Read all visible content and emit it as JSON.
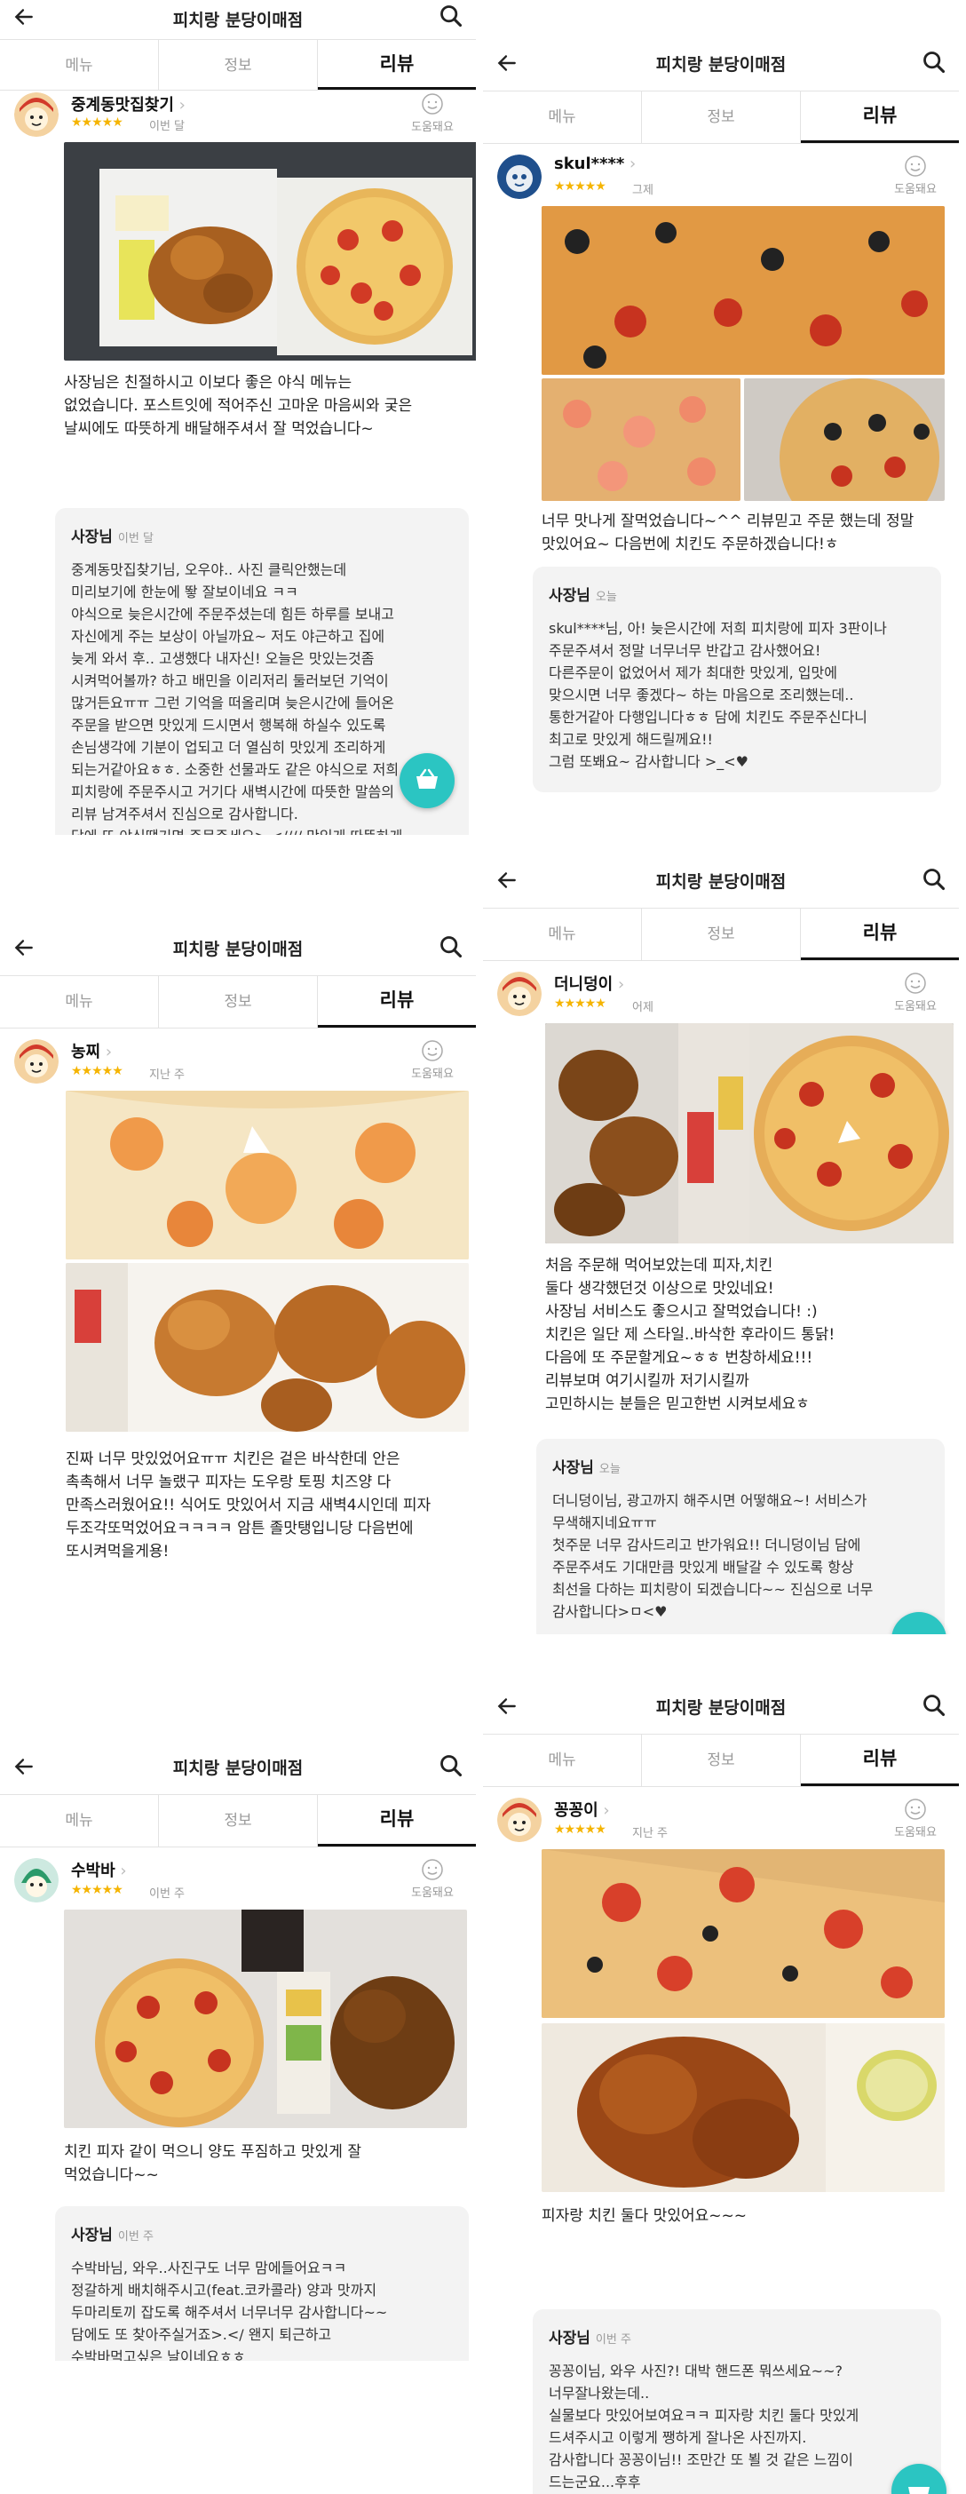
{
  "app": {
    "store_title": "피치랑 분당이매점",
    "tabs": [
      "메뉴",
      "정보",
      "리뷰"
    ],
    "helpful_label": "도움돼요",
    "owner_label": "사장님"
  },
  "reviews": [
    {
      "user": "중계동맛집찾기",
      "stars": "★★★★★",
      "when": "이번 달",
      "text": "사장님은 친절하시고 이보다 좋은 야식 메뉴는\n없었습니다. 포스트잇에 적어주신 고마운 마음씨와 궂은\n날씨에도 따뜻하게 배달해주셔서 잘 먹었습니다~",
      "reply_when": "이번 달",
      "reply": "중계동맛집찾기님,  오우야.. 사진 클릭안했는데\n미리보기에 한눈에 뙇 잘보이네요 ㅋㅋ\n야식으로 늦은시간에 주문주셨는데 힘든 하루를 보내고\n자신에게 주는 보상이 아닐까요~ 저도 야근하고 집에\n늦게 와서 후.. 고생했다 내자신! 오늘은 맛있는것좀\n시켜먹어볼까? 하고 배민을 이리저리 둘러보던 기억이\n많거든요ㅠㅠ 그런 기억을 떠올리며 늦은시간에 들어온\n주문을 받으면 맛있게 드시면서 행복해 하실수 있도록\n손님생각에 기분이 업되고 더 열심히 맛있게 조리하게\n되는거같아요ㅎㅎ. 소중한 선물과도 같은 야식으로 저희\n피치랑에 주문주시고 거기다 새벽시간에 따뜻한 말씀의\n리뷰 남겨주셔서 진심으로 감사합니다.\n 담에 또 야식땡기면 주문주세요>.<//// 맛있게 따뜻하게\n배달하겠습니다~!"
    },
    {
      "user": "skul****",
      "stars": "★★★★★",
      "when": "그제",
      "text": "너무 맛나게 잘먹었습니다~^^ 리뷰믿고 주문 했는데 정말\n맛있어요~ 다음번에 치킨도 주문하겠습니다!ㅎ",
      "reply_when": "오늘",
      "reply": "skul****님,  아! 늦은시간에 저희 피치랑에 피자 3판이나\n주문주셔서 정말 너무너무 반갑고 감사했어요!\n다른주문이 없었어서 제가 최대한 맛있게, 입맛에\n맞으시면 너무 좋겠다~ 하는 마음으로 조리했는데..\n통한거같아 다행입니다ㅎㅎ  담에 치킨도 주문주신다니\n최고로 맛있게 해드릴께요!!\n그럼 또봬요~ 감사합니다 >_<♥"
    },
    {
      "user": "농찌",
      "stars": "★★★★★",
      "when": "지난 주",
      "text": "진짜 너무 맛있었어요ㅠㅠ 치킨은 겉은 바삭한데 안은\n촉촉해서 너무 놀랬구 피자는 도우랑 토핑 치즈양 다\n만족스러웠어요!! 식어도 맛있어서 지금 새벽4시인데 피자\n두조각또먹었어요ㅋㅋㅋㅋ 암튼 졸맛탱입니당 다음번에\n또시켜먹을게용!"
    },
    {
      "user": "더니덩이",
      "stars": "★★★★★",
      "when": "어제",
      "text": "처음 주문해 먹어보았는데 피자,치킨\n둘다 생각했던것 이상으로 맛있네요!\n사장님 서비스도 좋으시고 잘먹었습니다! :)\n치킨은 일단 제 스타일..바삭한 후라이드 통닭!\n다음에 또 주문할게요~ㅎㅎ 번창하세요!!!\n리뷰보며 여기시킬까 저기시킬까\n고민하시는 분들은 믿고한번 시켜보세요ㅎ",
      "reply_when": "오늘",
      "reply": "더니덩이님, 광고까지 해주시면 어떻해요~! 서비스가\n무색해지네요ㅠㅠ\n첫주문 너무 감사드리고 반가워요!! 더니덩이님 담에\n주문주셔도 기대만큼 맛있게 배달갈 수 있도록 항상\n최선을 다하는 피치랑이 되겠습니다~~ 진심으로 너무\n감사합니다>ㅁ<♥"
    },
    {
      "user": "수박바",
      "stars": "★★★★★",
      "when": "이번 주",
      "text": "치킨 피자 같이 먹으니 양도 푸짐하고 맛있게 잘\n먹었습니다~~",
      "reply_when": "이번 주",
      "reply": "수박바님, 와우..사진구도 너무 맘에들어요ㅋㅋ\n정갈하게 배치해주시고(feat.코카콜라) 양과 맛까지\n두마리토끼 잡도록 해주셔서 너무너무 감사합니다~~\n담에도 또 찾아주실거죠>.</  왠지 퇴근하고\n수박바먹고싶은 날이네요ㅎㅎ"
    },
    {
      "user": "꽁꽁이",
      "stars": "★★★★★",
      "when": "지난 주",
      "text": "피자랑 치킨 둘다 맛있어요~~~",
      "reply_when": "이번 주",
      "reply": "꽁꽁이님,  와우 사진?! 대박 핸드폰 뭐쓰세요~~?\n너무잘나왔는데..\n실물보다 맛있어보여요ㅋㅋ 피자랑 치킨 둘다 맛있게\n드셔주시고 이렇게 쨍하게 잘나온 사진까지.\n감사합니다 꽁꽁이님!! 조만간 또 뵐 것 같은 느낌이\n드는군요...후후\n담에 또봬요~ 정말정말 감사합니다. >ㅁ<♥"
    }
  ]
}
